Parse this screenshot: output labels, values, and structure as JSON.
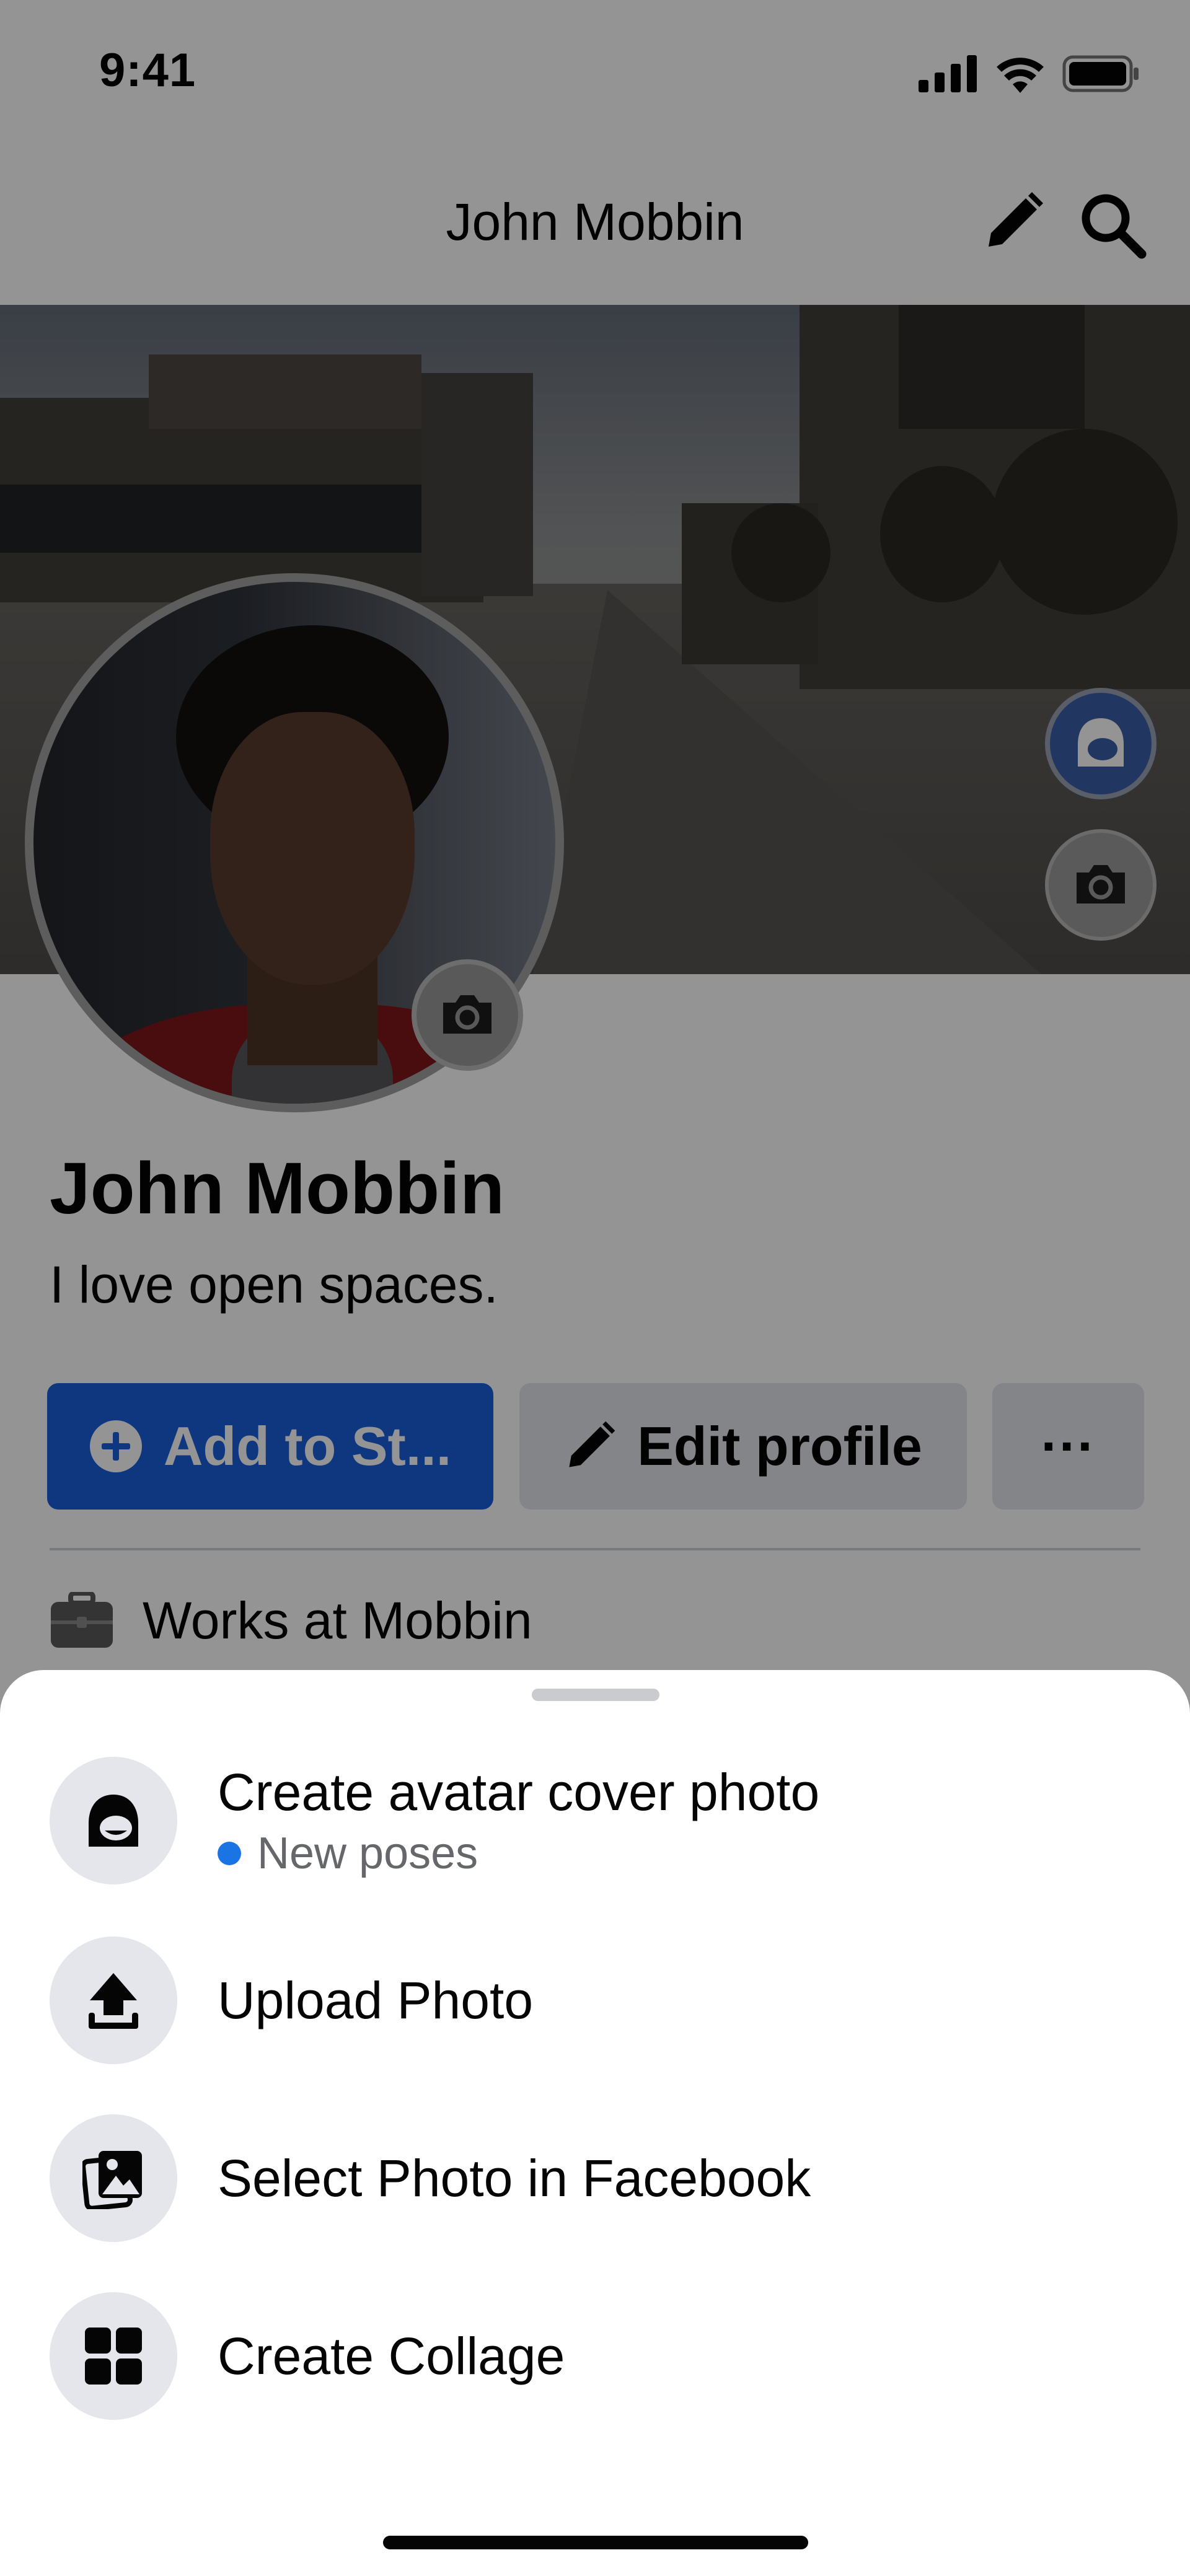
{
  "status_bar": {
    "time": "9:41"
  },
  "nav": {
    "title": "John Mobbin"
  },
  "profile": {
    "name": "John Mobbin",
    "bio": "I love open spaces.",
    "work": "Works at Mobbin"
  },
  "actions": {
    "add_story_label": "Add to St...",
    "edit_profile_label": "Edit profile",
    "more_label": "···"
  },
  "sheet": {
    "items": [
      {
        "label": "Create avatar cover photo",
        "sub": "New poses",
        "icon": "avatar-icon"
      },
      {
        "label": "Upload Photo",
        "icon": "upload-icon"
      },
      {
        "label": "Select Photo in Facebook",
        "icon": "photo-gallery-icon"
      },
      {
        "label": "Create Collage",
        "icon": "collage-grid-icon"
      }
    ]
  },
  "colors": {
    "accent": "#1B5FDD",
    "dot": "#1B74E4",
    "secondary_bg": "#E4E6EB",
    "text": "#050505",
    "muted": "#65676B"
  }
}
